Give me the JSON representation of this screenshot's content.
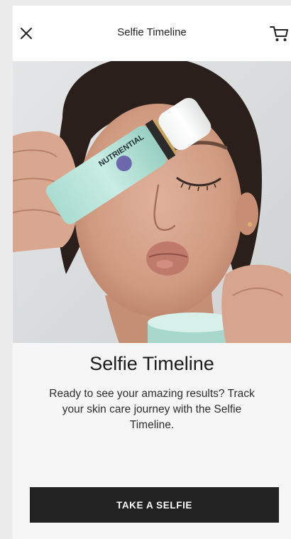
{
  "header": {
    "title": "Selfie Timeline",
    "close_icon": "close-icon",
    "cart_icon": "cart-icon"
  },
  "hero": {
    "product_label": "NUTRIENTIAL"
  },
  "content": {
    "title": "Selfie Timeline",
    "description": "Ready to see your amazing results? Track your skin care journey with the Selfie Timeline."
  },
  "cta": {
    "label": "TAKE A SELFIE"
  }
}
